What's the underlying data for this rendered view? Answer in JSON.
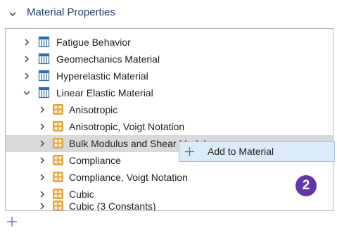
{
  "section": {
    "title": "Material Properties",
    "expanded": true,
    "chevron_icon": "chevron-down-icon"
  },
  "tree": {
    "items": [
      {
        "label": "Fatigue Behavior",
        "icon": "table-icon",
        "expanded": false
      },
      {
        "label": "Geomechanics Material",
        "icon": "table-icon",
        "expanded": false
      },
      {
        "label": "Hyperelastic Material",
        "icon": "table-icon",
        "expanded": false
      },
      {
        "label": "Linear Elastic Material",
        "icon": "table-icon",
        "expanded": true
      },
      {
        "label": "Anisotropic",
        "icon": "property-group-icon",
        "expanded": false
      },
      {
        "label": "Anisotropic, Voigt Notation",
        "icon": "property-group-icon",
        "expanded": false
      },
      {
        "label": "Bulk Modulus and Shear Modulus",
        "icon": "property-group-icon",
        "expanded": false,
        "selected": true
      },
      {
        "label": "Compliance",
        "icon": "property-group-icon",
        "expanded": false
      },
      {
        "label": "Compliance, Voigt Notation",
        "icon": "property-group-icon",
        "expanded": false
      },
      {
        "label": "Cubic",
        "icon": "property-group-icon",
        "expanded": false
      },
      {
        "label": "Cubic (3 Constants)",
        "icon": "property-group-icon",
        "expanded": false
      }
    ]
  },
  "context_menu": {
    "items": [
      {
        "label": "Add to Material",
        "icon": "plus-icon"
      }
    ]
  },
  "step_badge": {
    "label": "2",
    "color": "#6236a8"
  },
  "bottom_toolbar": {
    "add_icon": "plus-icon"
  },
  "colors": {
    "section_title": "#1f3f6e",
    "table_icon": "#2b6cb0",
    "property_icon": "#e8a23c",
    "selected_row": "#d9d9d9",
    "menu_highlight": "#dcebfa"
  }
}
